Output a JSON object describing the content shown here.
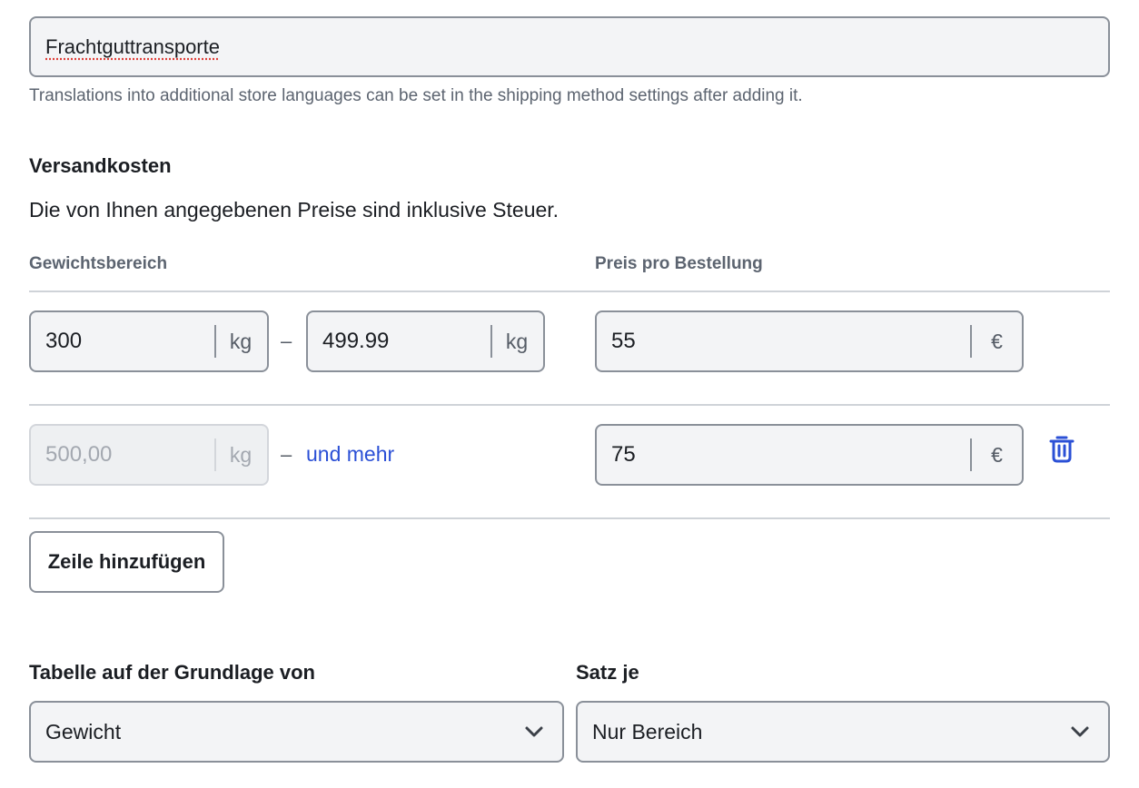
{
  "shipping_name": {
    "value": "Frachtguttransporte",
    "help_text": "Translations into additional store languages can be set in the shipping method settings after adding it."
  },
  "costs": {
    "heading": "Versandkosten",
    "note": "Die von Ihnen angegebenen Preise sind inklusive Steuer.",
    "col_range": "Gewichtsbereich",
    "col_price": "Preis pro Bestellung",
    "rows": [
      {
        "from": "300",
        "from_unit": "kg",
        "separator": "–",
        "to": "499.99",
        "to_unit": "kg",
        "price": "55",
        "currency": "€"
      },
      {
        "from": "500,00",
        "from_unit": "kg",
        "separator": "–",
        "to_link": "und mehr",
        "price": "75",
        "currency": "€",
        "delete_icon": "trash-icon"
      }
    ],
    "add_row_label": "Zeile hinzufügen"
  },
  "table_basis": {
    "label": "Tabelle auf der Grundlage von",
    "value": "Gewicht"
  },
  "rate_per": {
    "label": "Satz je",
    "value": "Nur Bereich"
  },
  "colors": {
    "link": "#2b50d6",
    "delete_icon": "#2b50d6",
    "border": "#8a9099",
    "input_bg": "#f3f4f6"
  }
}
